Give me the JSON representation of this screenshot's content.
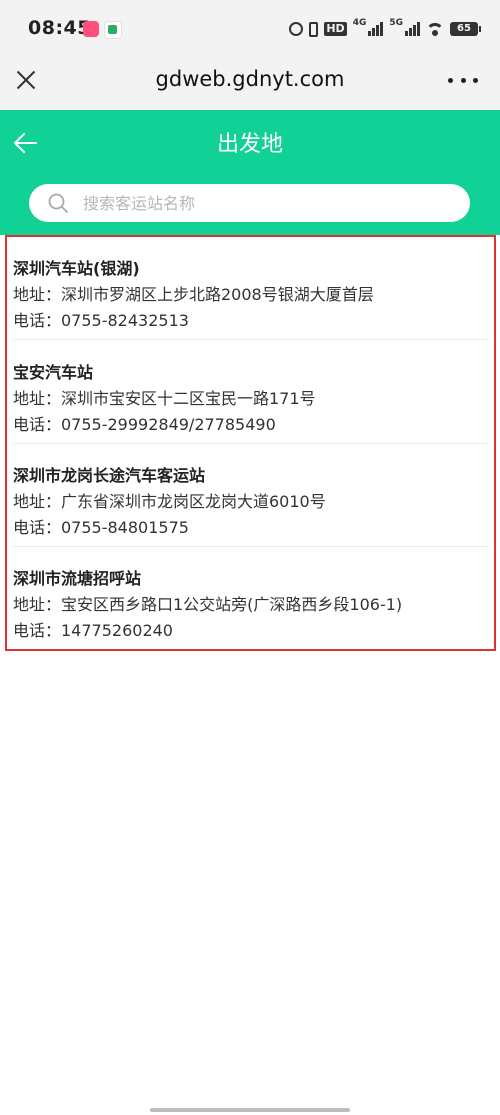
{
  "status_bar": {
    "time": "08:45",
    "hd_label": "HD",
    "net_4g": "4G",
    "net_5g": "5G",
    "battery": "65"
  },
  "browser": {
    "url": "gdweb.gdnyt.com"
  },
  "header": {
    "title": "出发地"
  },
  "search": {
    "placeholder": "搜索客运站名称"
  },
  "stations": [
    {
      "name": "深圳汽车站(银湖)",
      "address": "地址：深圳市罗湖区上步北路2008号银湖大厦首层",
      "phone": "电话：0755-82432513"
    },
    {
      "name": "宝安汽车站",
      "address": "地址：深圳市宝安区十二区宝民一路171号",
      "phone": "电话：0755-29992849/27785490"
    },
    {
      "name": "深圳市龙岗长途汽车客运站",
      "address": "地址：广东省深圳市龙岗区龙岗大道6010号",
      "phone": "电话：0755-84801575"
    },
    {
      "name": "深圳市流塘招呼站",
      "address": "地址：宝安区西乡路口1公交站旁(广深路西乡段106-1)",
      "phone": "电话：14775260240"
    }
  ],
  "colors": {
    "header_green": "#11d196",
    "highlight_red": "#e03131"
  },
  "icons": {
    "close": "close-icon",
    "more": "more-icon",
    "back": "back-arrow-icon",
    "search": "search-icon"
  }
}
